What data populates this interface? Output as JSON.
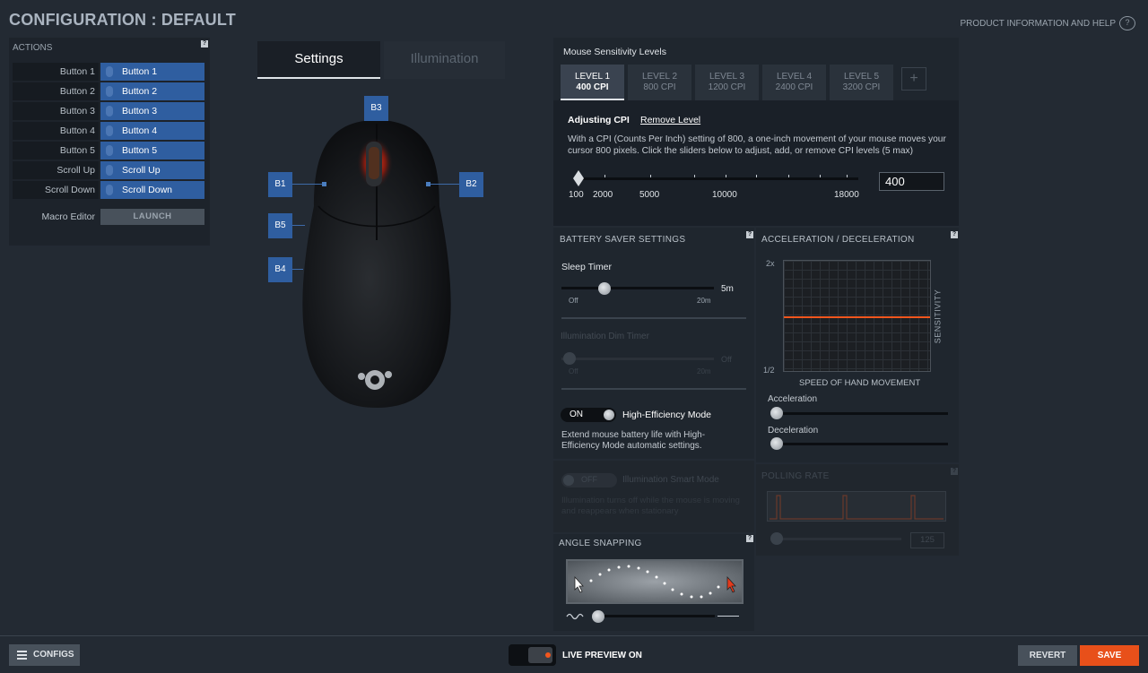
{
  "header": {
    "title": "CONFIGURATION : DEFAULT",
    "help_link": "PRODUCT INFORMATION AND HELP",
    "help_icon": "help-cloud-icon"
  },
  "actions": {
    "title": "ACTIONS",
    "help": "?",
    "rows": [
      {
        "label": "Button 1",
        "value": "Button 1"
      },
      {
        "label": "Button 2",
        "value": "Button 2"
      },
      {
        "label": "Button 3",
        "value": "Button 3"
      },
      {
        "label": "Button 4",
        "value": "Button 4"
      },
      {
        "label": "Button 5",
        "value": "Button 5"
      },
      {
        "label": "Scroll Up",
        "value": "Scroll Up"
      },
      {
        "label": "Scroll Down",
        "value": "Scroll Down"
      }
    ],
    "macro_label": "Macro Editor",
    "launch": "LAUNCH"
  },
  "tabs": {
    "settings": "Settings",
    "illumination": "Illumination"
  },
  "mouse_buttons": {
    "b1": "B1",
    "b2": "B2",
    "b3": "B3",
    "b4": "B4",
    "b5": "B5"
  },
  "cpi": {
    "title": "Mouse Sensitivity Levels",
    "levels": [
      {
        "name": "LEVEL 1",
        "value": "400 CPI"
      },
      {
        "name": "LEVEL 2",
        "value": "800 CPI"
      },
      {
        "name": "LEVEL 3",
        "value": "1200 CPI"
      },
      {
        "name": "LEVEL 4",
        "value": "2400 CPI"
      },
      {
        "name": "LEVEL 5",
        "value": "3200 CPI"
      }
    ],
    "add": "+",
    "adjusting": "Adjusting CPI",
    "remove": "Remove Level",
    "description": "With a CPI (Counts Per Inch) setting of 800, a one-inch movement of your mouse moves your cursor 800 pixels. Click the sliders below to adjust, add, or remove CPI levels (5 max)",
    "scale": [
      "100",
      "2000",
      "5000",
      "10000",
      "18000"
    ],
    "input_value": "400"
  },
  "battery": {
    "title": "BATTERY SAVER SETTINGS",
    "help": "?",
    "sleep_label": "Sleep Timer",
    "sleep_value": "5m",
    "sleep_min": "Off",
    "sleep_max": "20m",
    "dim_label": "Illumination Dim Timer",
    "dim_value": "Off",
    "dim_min": "Off",
    "dim_max": "20m",
    "hem_toggle": "ON",
    "hem_label": "High-Efficiency Mode",
    "hem_desc": "Extend mouse battery life with High-Efficiency Mode automatic settings."
  },
  "smart": {
    "toggle": "OFF",
    "label": "Illumination Smart Mode",
    "desc": "Illumination turns off while the mouse is moving and reappears when stationary"
  },
  "angle": {
    "title": "ANGLE SNAPPING",
    "help": "?"
  },
  "acceleration": {
    "title": "ACCELERATION / DECELERATION",
    "help": "?",
    "y_top": "2x",
    "y_bottom": "1/2",
    "y_axis": "SENSITIVITY",
    "x_axis": "SPEED OF HAND MOVEMENT",
    "accel_label": "Acceleration",
    "decel_label": "Deceleration"
  },
  "polling": {
    "title": "POLLING RATE",
    "help": "?",
    "value": "125"
  },
  "footer": {
    "configs": "CONFIGS",
    "live_preview": "LIVE PREVIEW ON",
    "revert": "REVERT",
    "save": "SAVE"
  },
  "colors": {
    "accent": "#e8501a",
    "button_blue": "#2f5ea0",
    "background": "#232a33"
  }
}
